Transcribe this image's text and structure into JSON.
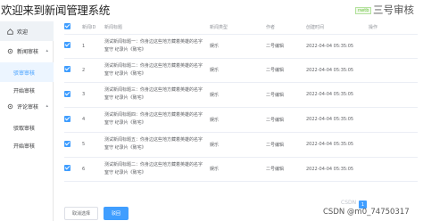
{
  "header": {
    "app_title": "欢迎来到新闻管理系统",
    "user_tag": "nwtb",
    "user_name": "三号审核"
  },
  "sidebar": {
    "items": [
      {
        "label": "欢迎",
        "icon": "home-icon"
      },
      {
        "label": "新闻审核",
        "icon": "gear-icon"
      },
      {
        "label": "驳审审核"
      },
      {
        "label": "开始审核"
      },
      {
        "label": "评论审核",
        "icon": "gear-icon"
      },
      {
        "label": "驳取审核"
      },
      {
        "label": "开始审核"
      }
    ]
  },
  "table": {
    "columns": [
      "",
      "新闻ID",
      "新闻标题",
      "新闻类型",
      "作者",
      "创建时间",
      "操作"
    ],
    "rows": [
      {
        "id": "1",
        "title": "测试新闻标题一：你身边这些地方藏着英雄的名字 窒守 纪录片《致宅》",
        "type": "娱乐",
        "author": "二号编辑",
        "time": "2022-04-04 05:35:05"
      },
      {
        "id": "2",
        "title": "测试新闻标题二：你身边这些地方藏着英雄的名字 窒守 纪录片《致宅》",
        "type": "娱乐",
        "author": "二号编辑",
        "time": "2022-04-04 05:35:05"
      },
      {
        "id": "3",
        "title": "测试新闻标题三：你身边这些地方藏着英雄的名字 窒守 纪录片《致宅》",
        "type": "娱乐",
        "author": "二号编辑",
        "time": "2022-04-04 05:35:05"
      },
      {
        "id": "4",
        "title": "测试新闻标题四：你身边这些地方藏着英雄的名字 窒守 纪录片《致宅》",
        "type": "娱乐",
        "author": "二号编辑",
        "time": "2022-04-04 05:35:05"
      },
      {
        "id": "5",
        "title": "测试新闻标题五：你身边这些地方藏着英雄的名字 窒守 纪录片《致宅》",
        "type": "娱乐",
        "author": "二号编辑",
        "time": "2022-04-04 05:35:05"
      },
      {
        "id": "6",
        "title": "测试新闻标题二：你身边这些地方藏着英雄的名字 窒守 纪录片《致宅》",
        "type": "娱乐",
        "author": "二号编辑",
        "time": "2022-04-04 05:35:05"
      }
    ]
  },
  "buttons": {
    "cancel_label": "取消选择",
    "approve_label": "驳回"
  },
  "pagination": {
    "current": "1"
  },
  "watermark": "CSDN @m0_74750317",
  "watermark_left": "CSDN",
  "colors": {
    "accent": "#409eff"
  }
}
